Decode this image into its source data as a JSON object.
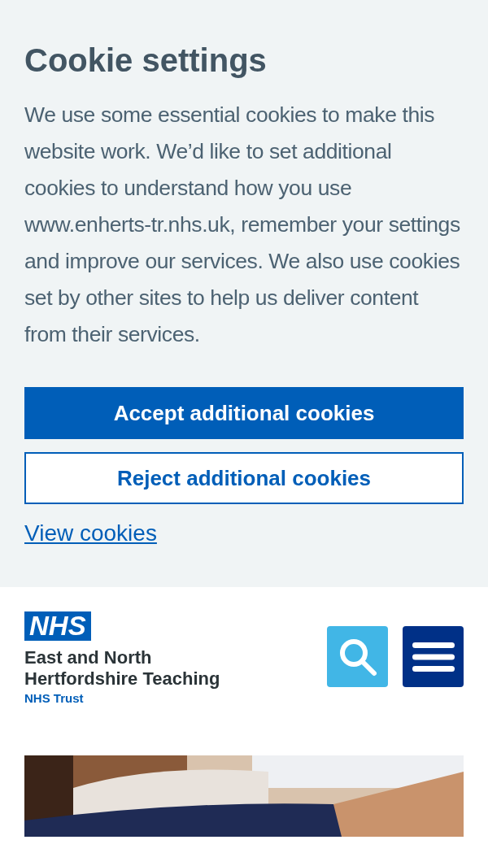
{
  "cookie_banner": {
    "title": "Cookie settings",
    "body": "We use some essential cookies to make this website work. We’d like to set additional cookies to understand how you use www.enherts-tr.nhs.uk, remember your settings and improve our services. We also use cookies set by other sites to help us deliver content from their services.",
    "buttons": [
      {
        "label": "Accept additional cookies",
        "kind": "primary"
      },
      {
        "label": "Reject additional cookies",
        "kind": "secondary"
      }
    ],
    "link": "View cookies"
  },
  "header": {
    "logo_mark": "NHS",
    "organisation": [
      "East and North",
      "Hertfordshire Teaching"
    ],
    "trust": "NHS Trust"
  }
}
